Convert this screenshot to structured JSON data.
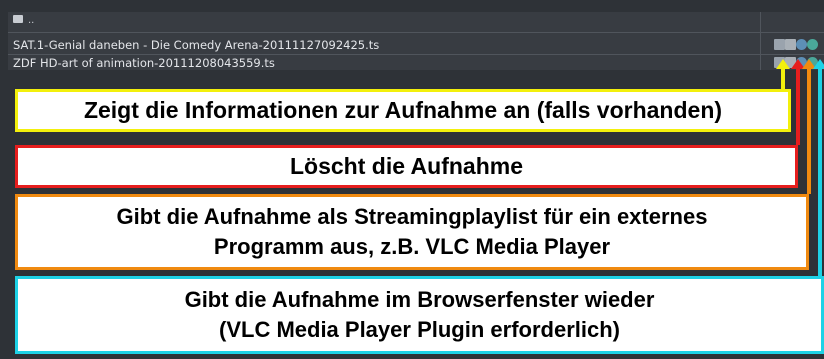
{
  "file_list": {
    "parent_dir": "..",
    "rows": [
      {
        "name": "SAT.1-Genial daneben - Die Comedy Arena-20111127092425.ts"
      },
      {
        "name": "ZDF HD-art of animation-20111208043559.ts"
      }
    ],
    "row_icons": [
      "info-icon",
      "delete-icon",
      "streaming-playlist-icon",
      "browser-play-icon"
    ]
  },
  "callouts": {
    "info": "Zeigt die Informationen zur Aufnahme an (falls vorhanden)",
    "delete": "Löscht die Aufnahme",
    "streaming_line1": "Gibt die Aufnahme als Streamingplaylist für ein externes",
    "streaming_line2": "Programm aus, z.B. VLC Media Player",
    "browser_line1": "Gibt die Aufnahme im Browserfenster wieder",
    "browser_line2": "(VLC Media Player Plugin erforderlich)"
  },
  "colors": {
    "info": "#f3f00c",
    "delete": "#e61e1e",
    "streaming": "#f08a10",
    "browser": "#1ed2e6",
    "panel_bg": "#2e3237"
  }
}
